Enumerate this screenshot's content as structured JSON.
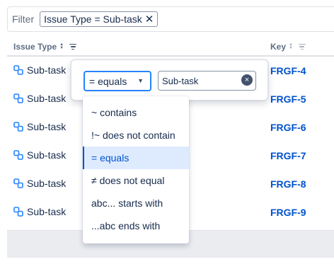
{
  "filter": {
    "label": "Filter",
    "chip_text": "Issue Type = Sub-task",
    "chip_remove": "✕"
  },
  "table": {
    "columns": [
      {
        "label": "Issue Type"
      },
      {
        "label": "Key"
      }
    ],
    "rows": [
      {
        "type": "Sub-task",
        "key": "FRGF-4"
      },
      {
        "type": "Sub-task",
        "key": "FRGF-5"
      },
      {
        "type": "Sub-task",
        "key": "FRGF-6"
      },
      {
        "type": "Sub-task",
        "key": "FRGF-7"
      },
      {
        "type": "Sub-task",
        "key": "FRGF-8"
      },
      {
        "type": "Sub-task",
        "key": "FRGF-9"
      }
    ]
  },
  "popup": {
    "operator_value": "= equals",
    "value_input": "Sub-task",
    "clear_symbol": "×"
  },
  "operator_options": [
    {
      "label": "~ contains",
      "selected": false
    },
    {
      "label": "!~ does not contain",
      "selected": false
    },
    {
      "label": "= equals",
      "selected": true
    },
    {
      "label": "≠ does not equal",
      "selected": false
    },
    {
      "label": "abc... starts with",
      "selected": false
    },
    {
      "label": "...abc ends with",
      "selected": false
    }
  ],
  "colors": {
    "link": "#0052cc",
    "accent": "#2684ff",
    "selected_bg": "#deebff",
    "text": "#172b4d"
  },
  "icons": {
    "row_icon": "subtask-icon",
    "chip_remove": "close-icon",
    "sort": "sort-icon",
    "filter": "filter-icon",
    "chevron": "chevron-down-icon"
  }
}
